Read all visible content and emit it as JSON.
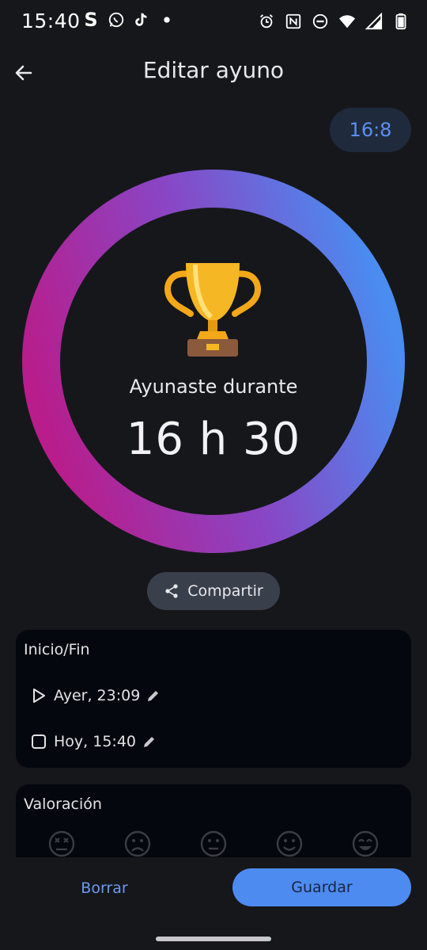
{
  "status_bar": {
    "time": "15:40",
    "left_icons": [
      "s-app-icon",
      "whatsapp-icon",
      "tiktok-icon",
      "notification-dot-icon"
    ],
    "right_icons": [
      "alarm-icon",
      "nfc-icon",
      "do-not-disturb-icon",
      "wifi-icon",
      "signal-icon",
      "battery-icon"
    ]
  },
  "header": {
    "title": "Editar ayuno",
    "back_icon": "arrow-left-icon"
  },
  "plan": {
    "label": "16:8"
  },
  "progress_ring": {
    "icon": "trophy-icon",
    "label": "Ayunaste durante",
    "value": "16 h 30",
    "progress": 1.0,
    "colors": {
      "start": "#b81d8b",
      "mid": "#8a45c4",
      "end": "#4a8cf0"
    }
  },
  "share": {
    "label": "Compartir",
    "icon": "share-icon"
  },
  "start_end": {
    "title": "Inicio/Fin",
    "start": {
      "icon": "play-icon",
      "text": "Ayer, 23:09"
    },
    "end": {
      "icon": "stop-icon",
      "text": "Hoy, 15:40"
    }
  },
  "rating": {
    "title": "Valoración",
    "faces": [
      "face-dizzy-icon",
      "face-sad-icon",
      "face-neutral-icon",
      "face-smile-icon",
      "face-happy-icon"
    ]
  },
  "actions": {
    "delete_label": "Borrar",
    "save_label": "Guardar"
  },
  "colors": {
    "background": "#16171b",
    "card": "#04070d",
    "accent": "#4d8bf0",
    "chip_bg": "#1f2a3d"
  }
}
